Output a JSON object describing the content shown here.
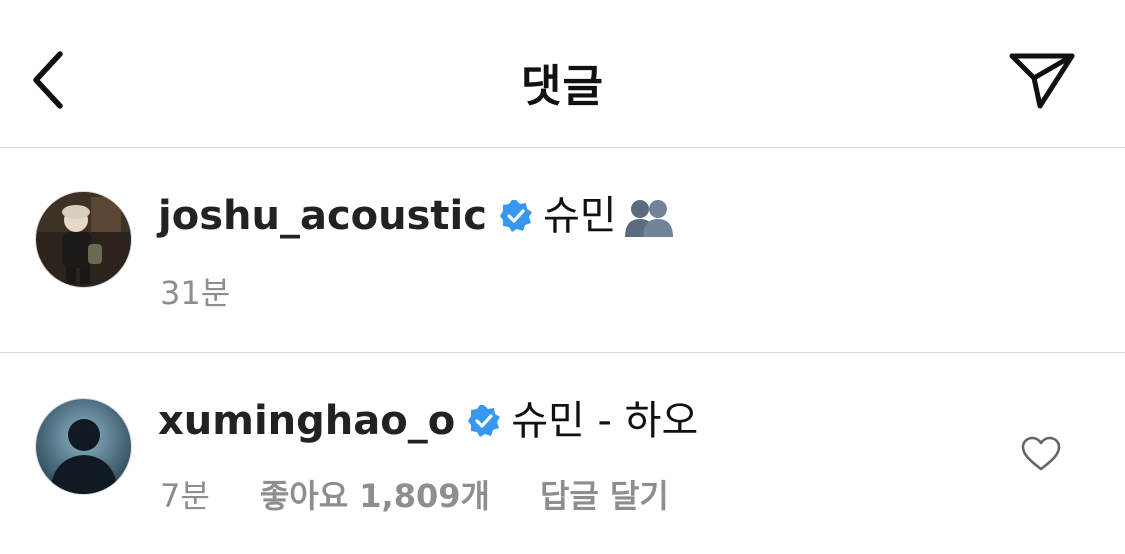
{
  "header": {
    "title": "댓글",
    "back_icon": "chevron-left-icon",
    "share_icon": "paper-plane-icon"
  },
  "comments": [
    {
      "username": "joshu_acoustic",
      "verified": true,
      "text": "슈민",
      "emoji": "busts-in-silhouette",
      "time": "31분"
    },
    {
      "username": "xuminghao_o",
      "verified": true,
      "text": "슈민 - 하오",
      "time": "7분",
      "likes": "좋아요 1,809개",
      "reply": "답글 달기"
    }
  ],
  "colors": {
    "verified_blue": "#3897f0",
    "secondary_text": "#8e8e8e",
    "divider": "#dbdbdb"
  }
}
